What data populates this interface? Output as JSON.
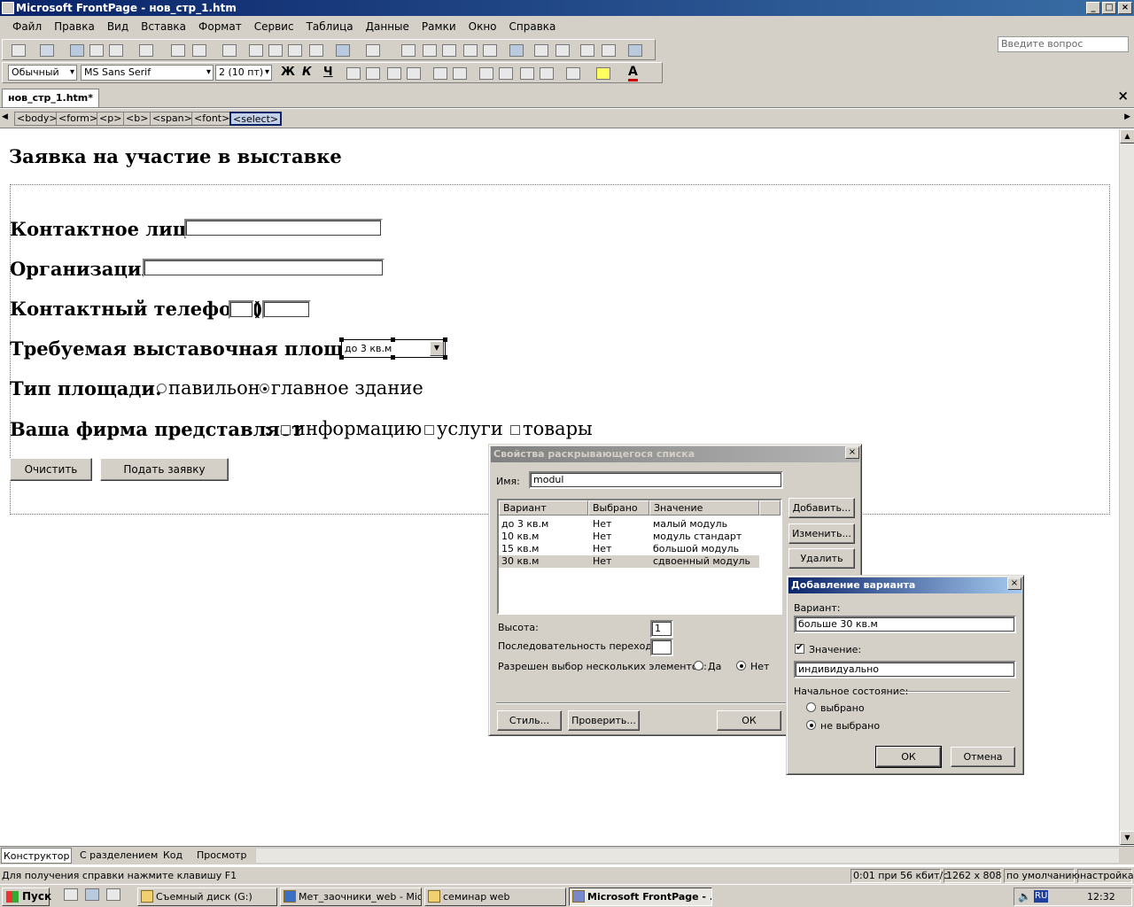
{
  "window": {
    "title": "Microsoft FrontPage - нов_стр_1.htm"
  },
  "menu": {
    "items": [
      "Файл",
      "Правка",
      "Вид",
      "Вставка",
      "Формат",
      "Сервис",
      "Таблица",
      "Данные",
      "Рамки",
      "Окно",
      "Справка"
    ],
    "help_placeholder": "Введите вопрос"
  },
  "format_toolbar": {
    "style": "Обычный",
    "font": "MS Sans Serif",
    "size": "2 (10 пт)",
    "bold": "Ж",
    "italic": "К",
    "underline": "Ч",
    "font_color": "A"
  },
  "document": {
    "tab": "нов_стр_1.htm*",
    "close": "×",
    "tags": [
      "<body>",
      "<form>",
      "<p>",
      "<b>",
      "<span>",
      "<font>",
      "<select>"
    ]
  },
  "page": {
    "heading": "Заявка на участие в выставке",
    "contact_label": "Контактное лицо",
    "org_label": "Организация",
    "phone_label": "Контактный телефон (",
    "phone_paren": ")",
    "area_label": "Требуемая выставочная площадь",
    "area_value": "до 3 кв.м",
    "type_label": "Тип площади:",
    "type_options": [
      "павильон",
      "главное здание"
    ],
    "firm_label": "Ваша фирма представляет",
    "firm_colon": ":",
    "firm_options": [
      "информацию",
      "услуги",
      "товары"
    ],
    "reset_button": "Очистить",
    "submit_button": "Подать заявку"
  },
  "dropdown_dialog": {
    "title": "Свойства раскрывающегося списка",
    "name_label": "Имя:",
    "name_value": "modul",
    "columns": [
      "Вариант",
      "Выбрано",
      "Значение"
    ],
    "rows": [
      [
        "до 3 кв.м",
        "Нет",
        "малый модуль"
      ],
      [
        "10 кв.м",
        "Нет",
        "модуль стандарт"
      ],
      [
        "15 кв.м",
        "Нет",
        "большой модуль"
      ],
      [
        "30 кв.м",
        "Нет",
        "сдвоенный модуль"
      ]
    ],
    "add": "Добавить...",
    "modify": "Изменить...",
    "remove": "Удалить",
    "height_label": "Высота:",
    "height_value": "1",
    "tab_order_label": "Последовательность перехода:",
    "tab_order_value": "",
    "multi_label": "Разрешен выбор нескольких элементов:",
    "multi_yes": "Да",
    "multi_no": "Нет",
    "style": "Стиль...",
    "validate": "Проверить...",
    "ok": "ОК"
  },
  "add_dialog": {
    "title": "Добавление варианта",
    "option_label": "Вариант:",
    "option_value": "больше 30 кв.м",
    "value_label": "Значение:",
    "value_value": "индивидуально",
    "state_label": "Начальное состояние:",
    "selected": "выбрано",
    "not_selected": "не выбрано",
    "ok": "ОК",
    "cancel": "Отмена"
  },
  "view_tabs": [
    "Конструктор",
    "С разделением",
    "Код",
    "Просмотр"
  ],
  "status": {
    "help": "Для получения справки нажмите клавишу F1",
    "speed": "0:01 при 56 кбит/с",
    "resolution": "1262 x 808",
    "default": "по умолчанию",
    "custom": "настройка"
  },
  "taskbar": {
    "start": "Пуск",
    "items": [
      "Съемный диск (G:)",
      "Мет_заочники_web - Mic...",
      "семинар web",
      "Microsoft FrontPage - ..."
    ],
    "lang": "RU",
    "time": "12:32"
  }
}
